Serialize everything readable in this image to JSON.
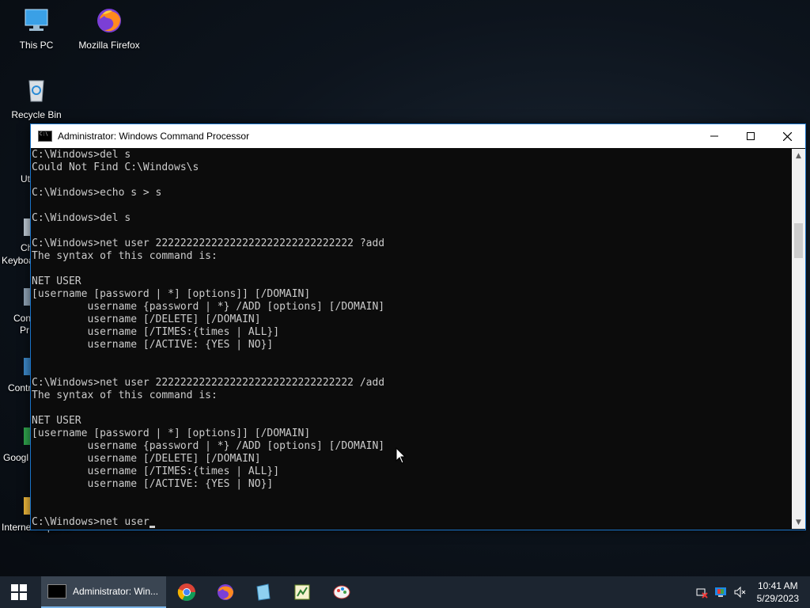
{
  "desktop": {
    "icons": [
      {
        "label": "This PC"
      },
      {
        "label": "Mozilla Firefox"
      },
      {
        "label": "Recycle Bin"
      }
    ],
    "partial_labels": [
      "Ut",
      "Ch",
      "Keyboa",
      "Con",
      "Pr",
      "Contr",
      "Googl",
      "Internet Explorer"
    ]
  },
  "window": {
    "title": "Administrator: Windows Command Processor",
    "console_lines": [
      "C:\\Windows>del s",
      "Could Not Find C:\\Windows\\s",
      "",
      "C:\\Windows>echo s > s",
      "",
      "C:\\Windows>del s",
      "",
      "C:\\Windows>net user 22222222222222222222222222222222 ?add",
      "The syntax of this command is:",
      "",
      "NET USER",
      "[username [password | *] [options]] [/DOMAIN]",
      "         username {password | *} /ADD [options] [/DOMAIN]",
      "         username [/DELETE] [/DOMAIN]",
      "         username [/TIMES:{times | ALL}]",
      "         username [/ACTIVE: {YES | NO}]",
      "",
      "",
      "C:\\Windows>net user 22222222222222222222222222222222 /add",
      "The syntax of this command is:",
      "",
      "NET USER",
      "[username [password | *] [options]] [/DOMAIN]",
      "         username {password | *} /ADD [options] [/DOMAIN]",
      "         username [/DELETE] [/DOMAIN]",
      "         username [/TIMES:{times | ALL}]",
      "         username [/ACTIVE: {YES | NO}]",
      "",
      "",
      "C:\\Windows>net user"
    ],
    "colors": {
      "background": "#0c0c0c",
      "text": "#cccccc",
      "border": "#1a73c7"
    }
  },
  "taskbar": {
    "active_task_label": "Administrator: Win...",
    "apps": [
      "chrome-icon",
      "firefox-icon",
      "notepad-icon",
      "editor-icon",
      "paint-icon"
    ],
    "clock": {
      "time": "10:41 AM",
      "date": "5/29/2023"
    }
  }
}
